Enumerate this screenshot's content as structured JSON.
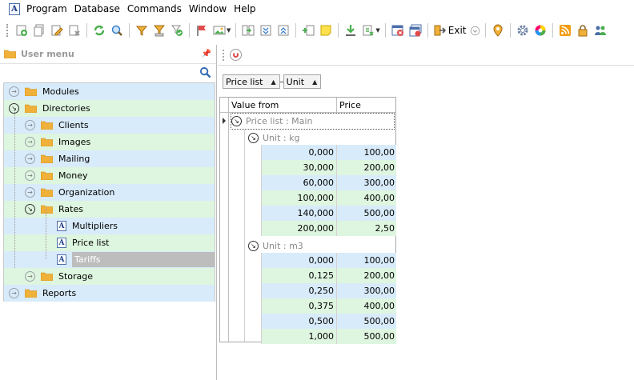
{
  "menubar": {
    "app_icon": "A",
    "items": [
      "Program",
      "Database",
      "Commands",
      "Window",
      "Help"
    ]
  },
  "toolbar": {
    "exit_label": "Exit",
    "icons": [
      "add-icon",
      "copy-icon",
      "edit-icon",
      "delete-icon",
      "refresh-icon",
      "search-icon",
      "filter-icon",
      "filter-clear-icon",
      "filter-apply-icon",
      "flag-icon",
      "image-icon",
      "link-icon",
      "collapse-icon",
      "expand-icon",
      "add-row-icon",
      "note-icon",
      "download-icon",
      "export-icon",
      "close-window-icon",
      "close-all-icon",
      "exit-icon",
      "location-pin-icon",
      "settings-icon",
      "color-wheel-icon",
      "rss-icon",
      "lock-icon",
      "users-icon"
    ]
  },
  "left_panel": {
    "title": "User menu",
    "tree": [
      {
        "label": "Modules",
        "level": 0,
        "type": "folder",
        "expander": "closed"
      },
      {
        "label": "Directories",
        "level": 0,
        "type": "folder",
        "expander": "open"
      },
      {
        "label": "Clients",
        "level": 1,
        "type": "folder",
        "expander": "closed"
      },
      {
        "label": "Images",
        "level": 1,
        "type": "folder",
        "expander": "closed"
      },
      {
        "label": "Mailing",
        "level": 1,
        "type": "folder",
        "expander": "closed"
      },
      {
        "label": "Money",
        "level": 1,
        "type": "folder",
        "expander": "closed"
      },
      {
        "label": "Organization",
        "level": 1,
        "type": "folder",
        "expander": "closed"
      },
      {
        "label": "Rates",
        "level": 1,
        "type": "folder",
        "expander": "open"
      },
      {
        "label": "Multipliers",
        "level": 2,
        "type": "doc"
      },
      {
        "label": "Price list",
        "level": 2,
        "type": "doc"
      },
      {
        "label": "Tariffs",
        "level": 2,
        "type": "doc",
        "selected": true
      },
      {
        "label": "Storage",
        "level": 1,
        "type": "folder",
        "expander": "closed"
      },
      {
        "label": "Reports",
        "level": 0,
        "type": "folder",
        "expander": "closed"
      }
    ]
  },
  "grouping": {
    "chips": [
      "Price list",
      "Unit"
    ]
  },
  "grid": {
    "columns": [
      "Value from",
      "Price"
    ],
    "group1": "Price list : Main",
    "groups": [
      {
        "label": "Unit : kg",
        "rows": [
          [
            "0,000",
            "100,00"
          ],
          [
            "30,000",
            "200,00"
          ],
          [
            "60,000",
            "300,00"
          ],
          [
            "100,000",
            "400,00"
          ],
          [
            "140,000",
            "500,00"
          ],
          [
            "200,000",
            "2,50"
          ]
        ]
      },
      {
        "label": "Unit : m3",
        "rows": [
          [
            "0,000",
            "100,00"
          ],
          [
            "0,125",
            "200,00"
          ],
          [
            "0,250",
            "300,00"
          ],
          [
            "0,375",
            "400,00"
          ],
          [
            "0,500",
            "500,00"
          ],
          [
            "1,000",
            "500,00"
          ]
        ]
      }
    ]
  },
  "colors": {
    "row_blue": "#d8ebfa",
    "row_green": "#def5df",
    "folder": "#f0b13a",
    "selected": "#bdbdbd"
  }
}
